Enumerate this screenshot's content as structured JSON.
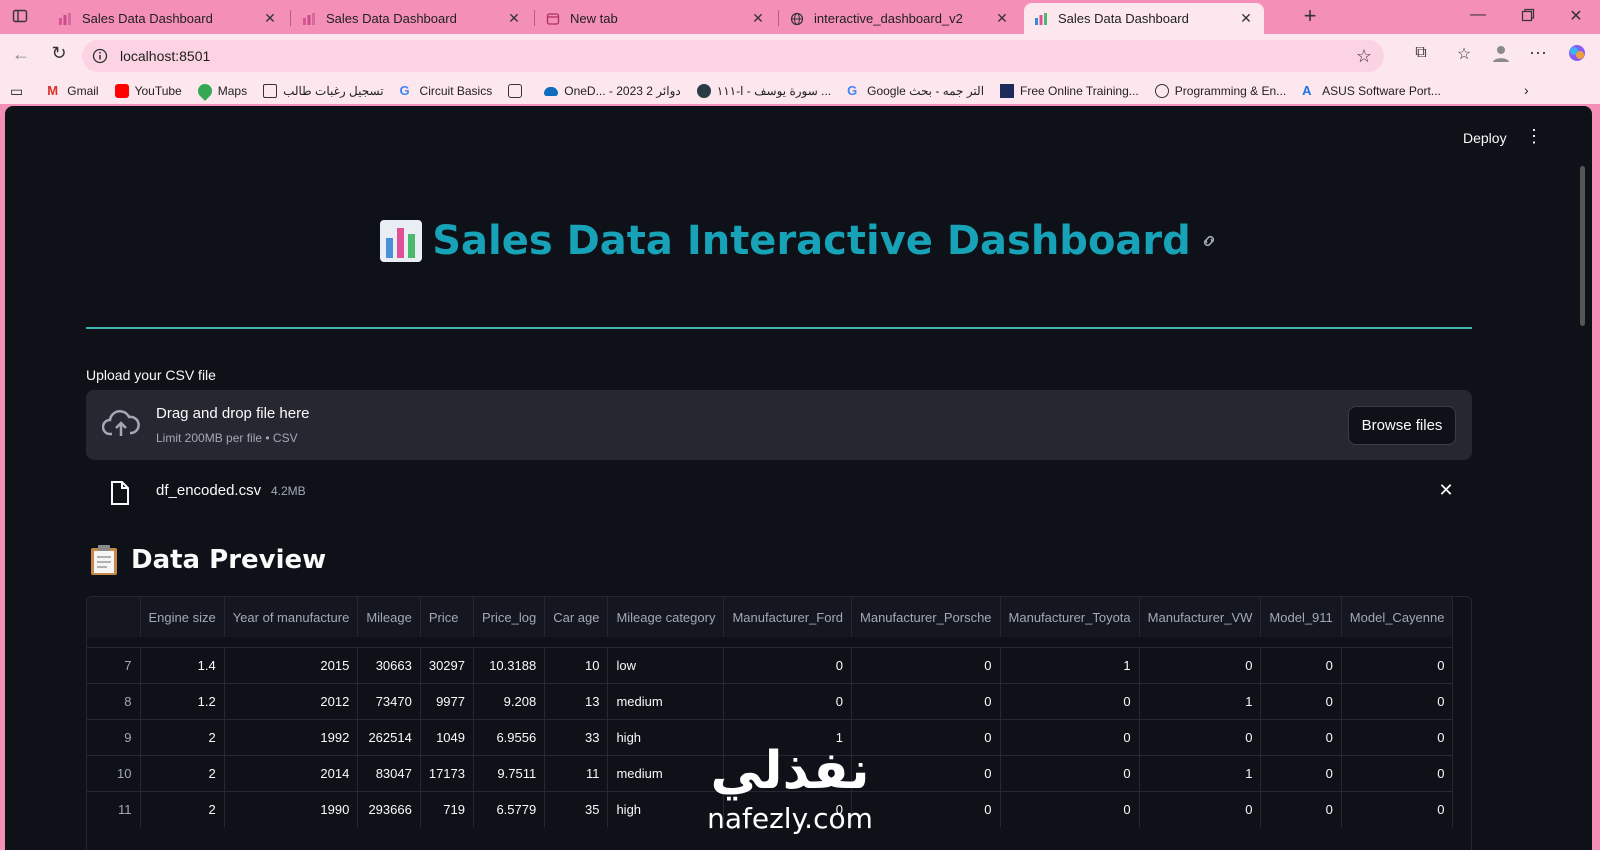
{
  "browser": {
    "tabs": [
      {
        "label": "Sales Data Dashboard",
        "active": false
      },
      {
        "label": "Sales Data Dashboard",
        "active": false
      },
      {
        "label": "New tab",
        "active": false
      },
      {
        "label": "interactive_dashboard_v2",
        "active": false
      },
      {
        "label": "Sales Data Dashboard",
        "active": true
      }
    ],
    "url": "localhost:8501",
    "bookmarks": [
      "Gmail",
      "YouTube",
      "Maps",
      "تسجيل رغبات طالب",
      "Circuit Basics",
      "",
      "OneD... - 2023 دوائر 2",
      "سورة يوسف - ا-١١١ ...",
      "Google التر جمه - بحث",
      "Free Online Training...",
      "Programming & En...",
      "ASUS Software Port..."
    ]
  },
  "app": {
    "deploy_label": "Deploy",
    "title": "Sales Data Interactive Dashboard",
    "uploader": {
      "label": "Upload your CSV file",
      "drop_title": "Drag and drop file here",
      "drop_sub": "Limit 200MB per file • CSV",
      "browse_label": "Browse files",
      "file_name": "df_encoded.csv",
      "file_size": "4.2MB"
    },
    "section_title": "Data Preview",
    "table": {
      "columns": [
        "",
        "Engine size",
        "Year of manufacture",
        "Mileage",
        "Price",
        "Price_log",
        "Car age",
        "Mileage category",
        "Manufacturer_Ford",
        "Manufacturer_Porsche",
        "Manufacturer_Toyota",
        "Manufacturer_VW",
        "Model_911",
        "Model_Cayenne"
      ],
      "rows": [
        [
          "7",
          "1.4",
          "2015",
          "30663",
          "30297",
          "10.3188",
          "10",
          "low",
          "0",
          "0",
          "1",
          "0",
          "0",
          "0"
        ],
        [
          "8",
          "1.2",
          "2012",
          "73470",
          "9977",
          "9.208",
          "13",
          "medium",
          "0",
          "0",
          "0",
          "1",
          "0",
          "0"
        ],
        [
          "9",
          "2",
          "1992",
          "262514",
          "1049",
          "6.9556",
          "33",
          "high",
          "1",
          "0",
          "0",
          "0",
          "0",
          "0"
        ],
        [
          "10",
          "2",
          "2014",
          "83047",
          "17173",
          "9.7511",
          "11",
          "medium",
          "0",
          "0",
          "0",
          "1",
          "0",
          "0"
        ],
        [
          "11",
          "2",
          "1990",
          "293666",
          "719",
          "6.5779",
          "35",
          "high",
          "0",
          "0",
          "0",
          "0",
          "0",
          "0"
        ]
      ]
    },
    "watermark": {
      "arabic": "نفذلي",
      "latin": "nafezly.com"
    }
  },
  "colors": {
    "accent": "#17a2b8",
    "app_bg": "#0e1117",
    "chrome": "#f48fb8"
  }
}
